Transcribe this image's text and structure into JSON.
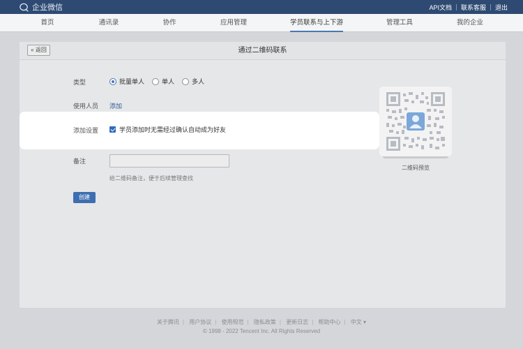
{
  "topbar": {
    "brand": "企业微信",
    "links": [
      "API文档",
      "联系客服",
      "退出"
    ]
  },
  "nav": {
    "items": [
      "首页",
      "通讯录",
      "协作",
      "应用管理",
      "学员联系与上下游",
      "管理工具",
      "我的企业"
    ],
    "active": "学员联系与上下游"
  },
  "panel": {
    "back": "« 返回",
    "title": "通过二维码联系"
  },
  "form": {
    "type_label": "类型",
    "type_options": [
      "批量单人",
      "单人",
      "多人"
    ],
    "type_selected": "批量单人",
    "user_label": "使用人员",
    "user_add": "添加",
    "setting_label": "添加设置",
    "setting_checkbox": "学员添加时无需经过确认自动成为好友",
    "setting_checked": true,
    "note_label": "备注",
    "note_value": "",
    "note_hint": "给二维码备注，便于后续管理查找",
    "create_button": "创建"
  },
  "qr": {
    "caption": "二维码预览"
  },
  "footer": {
    "links": [
      "关于腾讯",
      "用户协议",
      "使用规范",
      "隐私政策",
      "更新日志",
      "帮助中心",
      "中文 ▾"
    ],
    "copyright": "© 1998 - 2022 Tencent Inc. All Rights Reserved"
  },
  "colors": {
    "topbar": "#2e4a72",
    "accent": "#4a77b4",
    "button": "#3d6fb0"
  }
}
